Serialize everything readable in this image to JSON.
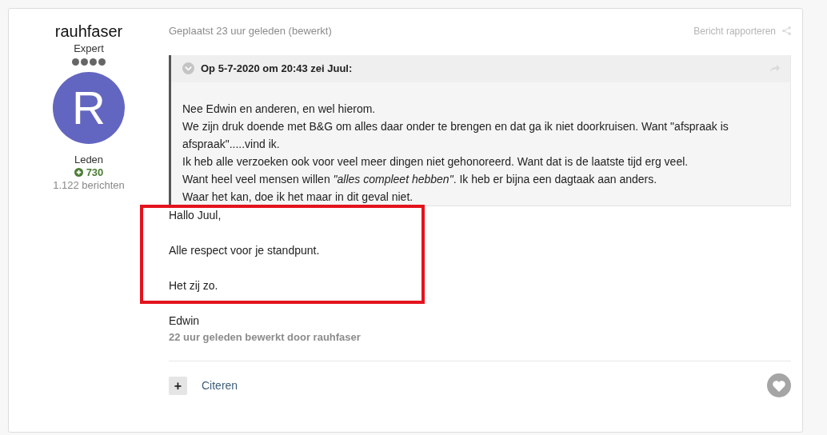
{
  "author": {
    "name": "rauhfaser",
    "rank": "Expert",
    "stars": 4,
    "avatar_letter": "R",
    "group": "Leden",
    "reputation": "730",
    "posts": "1.122 berichten"
  },
  "post": {
    "meta": "Geplaatst 23 uur geleden (bewerkt)",
    "report": "Bericht rapporteren",
    "quote": {
      "expanded": false,
      "citation": "Op 5-7-2020 om 20:43 zei Juul:",
      "lines": [
        "Nee Edwin en anderen, en wel hierom.",
        "We zijn druk doende met B&G om alles daar onder te brengen en dat ga ik niet doorkruisen. Want \"afspraak is afspraak\".....vind ik.",
        "Ik heb alle verzoeken ook voor veel meer dingen niet gehonoreerd. Want dat is de laatste tijd erg veel.",
        "Want heel veel mensen willen *\"alles compleet hebben\"*. Ik heb er bijna een dagtaak aan anders.",
        "Waar het kan, doe ik het maar in dit geval niet."
      ]
    },
    "highlighted_lines": [
      "Hallo Juul,",
      "Alle respect voor je standpunt.",
      "Het zij zo."
    ],
    "signature": "Edwin",
    "edit_note": "22 uur geleden bewerkt door rauhfaser",
    "actions": {
      "multiquote": "+",
      "quote": "Citeren"
    },
    "liked": false
  }
}
